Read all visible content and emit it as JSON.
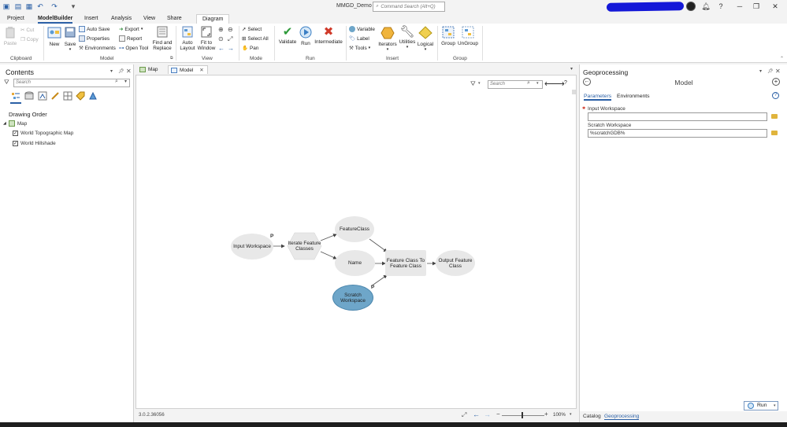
{
  "title_bar": {
    "app_title": "MMGD_Demo",
    "command_search_placeholder": "Command Search (Alt+Q)",
    "help": "?"
  },
  "tabs": [
    {
      "label": "Project"
    },
    {
      "label": "ModelBuilder"
    },
    {
      "label": "Insert"
    },
    {
      "label": "Analysis"
    },
    {
      "label": "View"
    },
    {
      "label": "Share"
    },
    {
      "label": "Diagram"
    }
  ],
  "ribbon": {
    "clipboard": {
      "paste": "Paste",
      "cut": "Cut",
      "copy": "Copy",
      "group": "Clipboard"
    },
    "model": {
      "new": "New",
      "save": "Save",
      "auto_save": "Auto Save",
      "properties": "Properties",
      "environments": "Environments",
      "export": "Export",
      "report": "Report",
      "open_tool": "Open Tool",
      "find_replace_1": "Find and",
      "find_replace_2": "Replace",
      "group": "Model"
    },
    "view": {
      "auto_layout_1": "Auto",
      "auto_layout_2": "Layout",
      "fit_1": "Fit to",
      "fit_2": "Window",
      "group": "View"
    },
    "mode": {
      "select": "Select",
      "select_all": "Select All",
      "pan": "Pan",
      "group": "Mode"
    },
    "run": {
      "validate": "Validate",
      "run": "Run",
      "intermediate": "Intermediate",
      "group": "Run"
    },
    "insert": {
      "variable": "Variable",
      "label": "Label",
      "tools": "Tools",
      "iterators": "Iterators",
      "utilities": "Utilities",
      "logical": "Logical",
      "group": "Insert"
    },
    "group_grp": {
      "group": "Group",
      "ungroup": "UnGroup",
      "group_label": "Group"
    }
  },
  "contents": {
    "title": "Contents",
    "search_placeholder": "Search",
    "drawing_order": "Drawing Order",
    "map": "Map",
    "layers": [
      {
        "name": "World Topographic Map",
        "checked": true
      },
      {
        "name": "World Hillshade",
        "checked": true
      }
    ]
  },
  "views": {
    "tabs": [
      {
        "label": "Map"
      },
      {
        "label": "Model"
      }
    ],
    "search_placeholder": "Search",
    "help": "?"
  },
  "model": {
    "nodes": {
      "input_workspace": "Input Workspace",
      "iterate_1": "Iterate Feature",
      "iterate_2": "Classes",
      "featureclass": "FeatureClass",
      "name": "Name",
      "fc_to_fc_1": "Feature Class To",
      "fc_to_fc_2": "Feature Class",
      "output_1": "Output Feature",
      "output_2": "Class",
      "scratch_1": "Scratch",
      "scratch_2": "Workspace"
    },
    "p_marker": "P",
    "colors": {
      "scratch": "#6ea6c9",
      "node": "#e8e8e8"
    }
  },
  "status": {
    "version": "3.0.2.36056",
    "zoom": "100%"
  },
  "geoprocessing": {
    "title": "Geoprocessing",
    "tool": "Model",
    "tabs": [
      {
        "label": "Parameters"
      },
      {
        "label": "Environments"
      }
    ],
    "params": [
      {
        "label": "Input Workspace",
        "value": ""
      },
      {
        "label": "Scratch Workspace",
        "value": "%scratchGDB%"
      }
    ],
    "run_label": "Run",
    "bottom_tabs": [
      {
        "label": "Catalog"
      },
      {
        "label": "Geoprocessing"
      }
    ]
  }
}
